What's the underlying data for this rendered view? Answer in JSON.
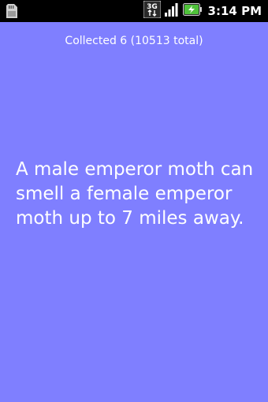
{
  "status_bar": {
    "time": "3:14 PM",
    "network_label": "3G",
    "icons": [
      "sd-card-icon",
      "network-3g-icon",
      "signal-strength-icon",
      "battery-charging-icon"
    ],
    "colors": {
      "background": "#000000",
      "text": "#ffffff",
      "battery": "#4fc23a"
    }
  },
  "main": {
    "collected_text": "Collected 6 (10513 total)",
    "fact_text": "A male emperor moth can smell a female emperor moth up to 7 miles away.",
    "background_color": "#7f7fff",
    "text_color": "#ffffff"
  }
}
